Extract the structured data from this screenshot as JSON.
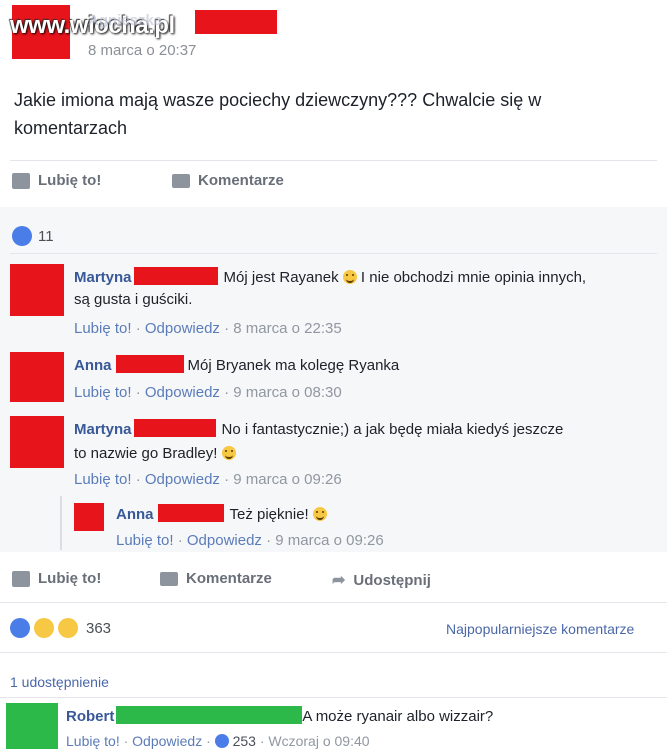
{
  "watermark": "www.wiocha.pl",
  "post": {
    "author_partial": "Agnieszka",
    "date": "8 marca o 20:37",
    "text": "Jakie imiona mają wasze pociechy dziewczyny??? Chwalcie się w komentarzach"
  },
  "actions1": {
    "like": "Lubię to!",
    "comment": "Komentarze"
  },
  "likes_count": "11",
  "comments": [
    {
      "name": "Martyna",
      "text": "Mój jest Rayanek",
      "text2": " I nie obchodzi mnie opinia innych,",
      "text3": "są gusta i guściki.",
      "like": "Lubię to!",
      "reply": "Odpowiedz",
      "time": "8 marca o 22:35"
    },
    {
      "name": "Anna",
      "text": "Mój Bryanek ma kolegę Ryanka",
      "like": "Lubię to!",
      "reply": "Odpowiedz",
      "time": "9 marca o 08:30"
    },
    {
      "name": "Martyna",
      "text": "No i fantastycznie;) a jak będę miała kiedyś jeszcze",
      "text2": "to nazwie go Bradley!",
      "like": "Lubię to!",
      "reply": "Odpowiedz",
      "time": "9 marca o 09:26"
    },
    {
      "name": "Anna",
      "text": "Też pięknie!",
      "like": "Lubię to!",
      "reply": "Odpowiedz",
      "time": "9 marca o 09:26"
    }
  ],
  "actions2": {
    "like": "Lubię to!",
    "comment": "Komentarze",
    "share": "Udostępnij"
  },
  "reactions_count": "363",
  "sort_label": "Najpopularniejsze komentarze",
  "shares": "1 udostępnienie",
  "last_comment": {
    "name": "Robert",
    "text": "A może ryanair albo wizzair?",
    "like": "Lubię to!",
    "reply": "Odpowiedz",
    "likes": "253",
    "time": "Wczoraj o 09:40"
  },
  "colors": {
    "redact": "#e8141b",
    "green": "#2db84a",
    "link": "#385898"
  }
}
